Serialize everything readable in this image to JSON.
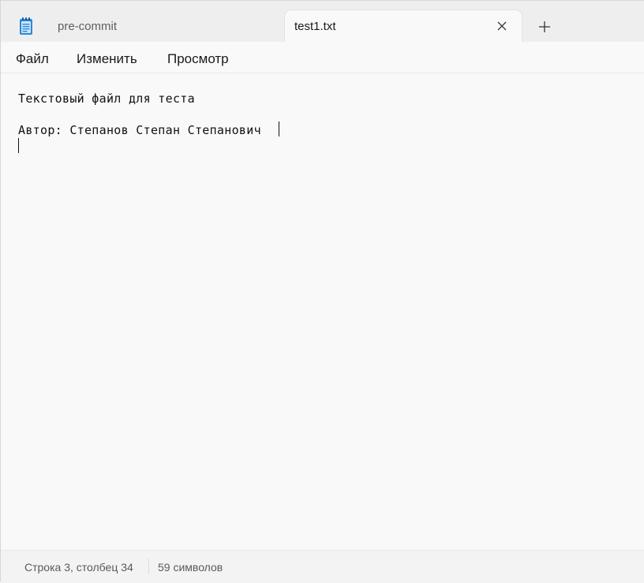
{
  "tabs": [
    {
      "label": "pre-commit"
    },
    {
      "label": "test1.txt"
    }
  ],
  "menu": {
    "file": "Файл",
    "edit": "Изменить",
    "view": "Просмотр"
  },
  "editor": {
    "lines": [
      "Текстовый файл для теста",
      "",
      "Автор: Степанов Степан Степанович",
      ""
    ]
  },
  "status": {
    "position": "Строка 3, столбец 34",
    "chars": "59 символов"
  },
  "colors": {
    "tabbar_bg": "#eeeeee",
    "editor_bg": "#f9f9f9",
    "app_icon": "#2b88d8"
  },
  "icons": {
    "app": "notepad-icon",
    "close": "close-icon",
    "new_tab": "plus-icon"
  }
}
